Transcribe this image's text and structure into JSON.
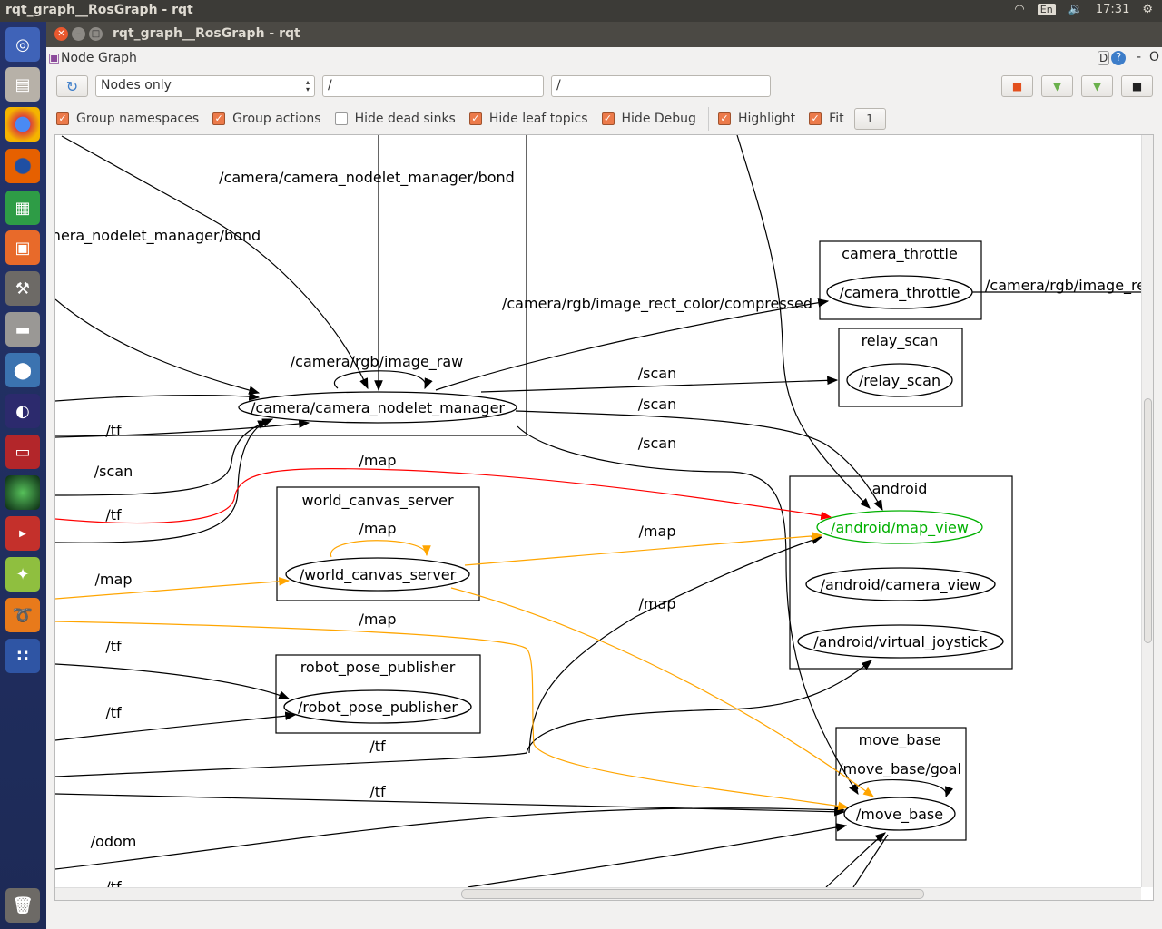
{
  "topbar": {
    "title": "rqt_graph__RosGraph - rqt",
    "lang": "En",
    "time": "17:31"
  },
  "window": {
    "title": "rqt_graph__RosGraph - rqt"
  },
  "plugin": {
    "title": "Node Graph",
    "d_label": "D",
    "help": "?",
    "minimize": "-",
    "close": "O"
  },
  "toolbar": {
    "mode": "Nodes only",
    "filter1": "/",
    "filter2": "/"
  },
  "options": [
    {
      "label": "Group namespaces",
      "checked": true
    },
    {
      "label": "Group actions",
      "checked": true
    },
    {
      "label": "Hide dead sinks",
      "checked": false
    },
    {
      "label": "Hide leaf topics",
      "checked": true
    },
    {
      "label": "Hide Debug",
      "checked": true
    },
    {
      "label": "Highlight",
      "checked": true
    },
    {
      "label": "Fit",
      "checked": true
    }
  ],
  "fit_button": "1",
  "colors": {
    "highlight_green": "#00b000",
    "map_edge": "#ffa500",
    "tf_edge_red": "#ff0000",
    "check": "#ec7a4a"
  },
  "graph": {
    "clusters": [
      "camera_throttle",
      "relay_scan",
      "android",
      "world_canvas_server",
      "robot_pose_publisher",
      "move_base"
    ],
    "nodes": [
      "/camera/camera_nodelet_manager",
      "/camera_throttle",
      "/relay_scan",
      "/android/map_view",
      "/android/camera_view",
      "/android/virtual_joystick",
      "/world_canvas_server",
      "/robot_pose_publisher",
      "/move_base"
    ],
    "edge_labels": [
      "/camera/camera_nodelet_manager/bond",
      "nera_nodelet_manager/bond",
      "/camera/rgb/image_rect_color/compressed",
      "/camera/rgb/image_re",
      "/camera/rgb/image_raw",
      "/scan",
      "/scan",
      "/scan",
      "/tf",
      "/scan",
      "/map",
      "/tf",
      "/map",
      "/map",
      "/map",
      "/map",
      "/map",
      "/tf",
      "/tf",
      "/tf",
      "/tf",
      "/odom",
      "/move_base/goal",
      "/tf"
    ]
  }
}
